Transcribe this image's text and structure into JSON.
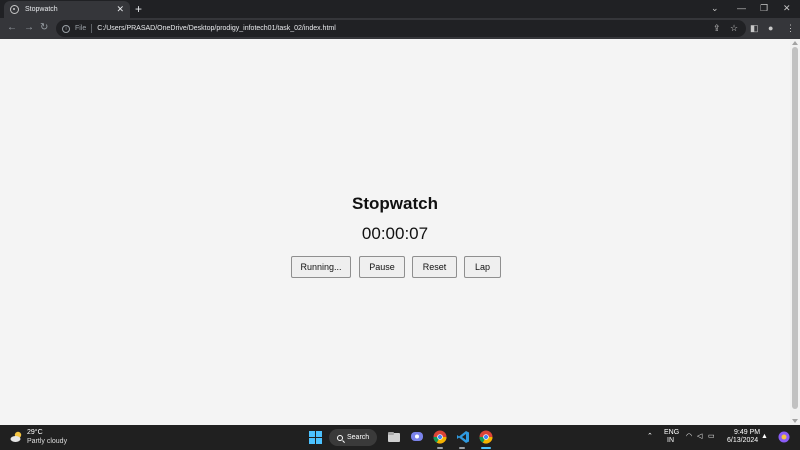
{
  "browser": {
    "tab_title": "Stopwatch",
    "tab_close": "✕",
    "new_tab": "+",
    "window_controls": {
      "dropdown": "⌄",
      "minimize": "—",
      "restore": "❐",
      "close": "✕"
    },
    "nav": {
      "back": "←",
      "forward": "→",
      "reload": "↻"
    },
    "address": {
      "scheme_label": "File",
      "url": "C:/Users/PRASAD/OneDrive/Desktop/prodigy_infotech01/task_02/index.html"
    },
    "toolbar_icons": {
      "share": "⇪",
      "bookmark": "☆",
      "sidepanel": "◧",
      "profile": "●",
      "menu": "⋮"
    }
  },
  "stopwatch": {
    "title": "Stopwatch",
    "time": "00:00:07",
    "buttons": {
      "start": "Running...",
      "pause": "Pause",
      "reset": "Reset",
      "lap": "Lap"
    }
  },
  "taskbar": {
    "weather": {
      "temperature": "29°C",
      "condition": "Partly cloudy"
    },
    "search_label": "Search",
    "tray": {
      "language": "ENG",
      "region": "IN",
      "time": "9:49 PM",
      "date": "6/13/2024",
      "chevron": "⌃"
    }
  },
  "colors": {
    "page_bg": "#f4f4f4",
    "browser_dark": "#202124",
    "browser_toolbar": "#35363a",
    "taskbar": "#202020",
    "windows_accent": "#4cc2ff"
  }
}
